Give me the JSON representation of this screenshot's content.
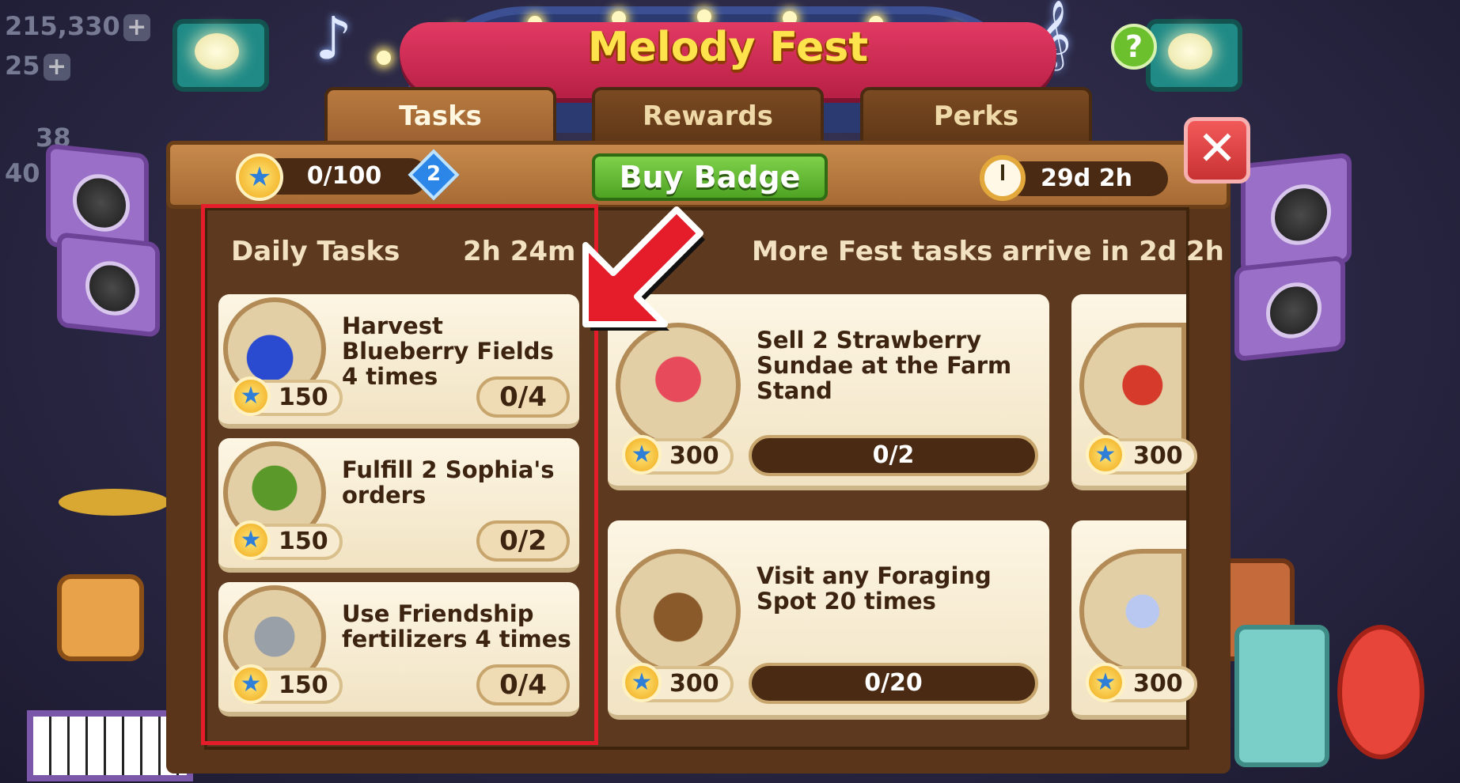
{
  "background": {
    "stats": [
      "215,330",
      "25",
      "38",
      "40"
    ]
  },
  "event": {
    "title": "Melody Fest"
  },
  "tabs": [
    {
      "label": "Tasks",
      "active": true
    },
    {
      "label": "Rewards",
      "active": false
    },
    {
      "label": "Perks",
      "active": false
    }
  ],
  "topbar": {
    "points": "0/100",
    "badge_level": "2",
    "buy_badge_label": "Buy Badge",
    "time_left": "29d 2h"
  },
  "daily": {
    "heading": "Daily Tasks",
    "timer": "2h 24m",
    "tasks": [
      {
        "title": "Harvest Blueberry Fields 4 times",
        "icon": "blueberry-icon",
        "reward": "150",
        "progress": "0/4"
      },
      {
        "title": "Fulfill 2 Sophia's orders",
        "icon": "sophia-house-icon",
        "reward": "150",
        "progress": "0/2"
      },
      {
        "title": "Use Friendship fertilizers 4 times",
        "icon": "fertilizer-icon",
        "reward": "150",
        "progress": "0/4"
      }
    ]
  },
  "fest": {
    "heading": "More Fest tasks arrive in 2d 2h",
    "tasks": [
      {
        "title": "Sell 2 Strawberry Sundae at the Farm Stand",
        "icon": "strawberry-sundae-icon",
        "reward": "300",
        "progress": "0/2"
      },
      {
        "title": "Visit any Foraging Spot 20 times",
        "icon": "foraging-basket-icon",
        "reward": "300",
        "progress": "0/20"
      },
      {
        "title": "",
        "icon": "pear-apple-icon",
        "reward": "300"
      },
      {
        "title": "",
        "icon": "bottle-icon",
        "reward": "300"
      }
    ]
  },
  "colors": {
    "highlight": "#e51d2a",
    "buy_button": "#4ea323",
    "banner": "#e23a63"
  }
}
